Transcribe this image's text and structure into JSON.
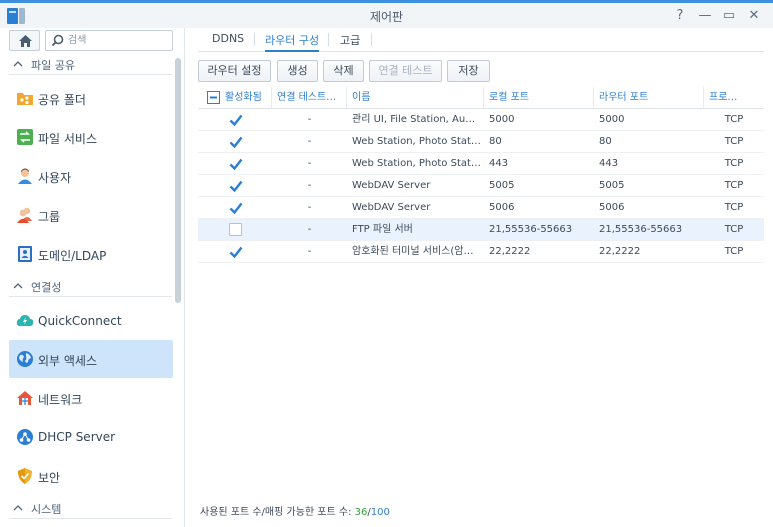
{
  "window": {
    "title": "제어판"
  },
  "title_buttons": {
    "help": "?",
    "minimize": "—",
    "maximize": "▭",
    "close": "✕"
  },
  "sidebar": {
    "search_placeholder": "검색",
    "sections": [
      {
        "label": "파일 공유"
      },
      {
        "label": "연결성"
      },
      {
        "label": "시스템"
      }
    ],
    "items": [
      {
        "label": "공유 폴더",
        "icon": "shared-folder-icon"
      },
      {
        "label": "파일 서비스",
        "icon": "file-services-icon"
      },
      {
        "label": "사용자",
        "icon": "user-icon"
      },
      {
        "label": "그룹",
        "icon": "group-icon"
      },
      {
        "label": "도메인/LDAP",
        "icon": "domain-ldap-icon"
      },
      {
        "label": "QuickConnect",
        "icon": "quickconnect-icon"
      },
      {
        "label": "외부 액세스",
        "icon": "external-access-icon",
        "active": true
      },
      {
        "label": "네트워크",
        "icon": "network-icon"
      },
      {
        "label": "DHCP Server",
        "icon": "dhcp-server-icon"
      },
      {
        "label": "보안",
        "icon": "security-shield-icon"
      }
    ]
  },
  "tabs": [
    {
      "label": "DDNS"
    },
    {
      "label": "라우터 구성",
      "active": true
    },
    {
      "label": "고급"
    }
  ],
  "toolbar": {
    "router_setup": "라우터 설정",
    "create": "생성",
    "delete": "삭제",
    "test_connection": "연결 테스트",
    "save": "저장"
  },
  "grid": {
    "headers": {
      "enabled": "활성화됨",
      "test_result": "연결 테스트…",
      "name": "이름",
      "local_port": "로컬 포트",
      "router_port": "라우터 포트",
      "protocol": "프로…"
    },
    "rows": [
      {
        "enabled": true,
        "test": "-",
        "name": "관리 UI, File Station, Au…",
        "local": "5000",
        "router": "5000",
        "proto": "TCP"
      },
      {
        "enabled": true,
        "test": "-",
        "name": "Web Station, Photo Stati…",
        "local": "80",
        "router": "80",
        "proto": "TCP"
      },
      {
        "enabled": true,
        "test": "-",
        "name": "Web Station, Photo Stati…",
        "local": "443",
        "router": "443",
        "proto": "TCP"
      },
      {
        "enabled": true,
        "test": "-",
        "name": "WebDAV Server",
        "local": "5005",
        "router": "5005",
        "proto": "TCP"
      },
      {
        "enabled": true,
        "test": "-",
        "name": "WebDAV Server",
        "local": "5006",
        "router": "5006",
        "proto": "TCP"
      },
      {
        "enabled": false,
        "test": "-",
        "name": "FTP 파일 서버",
        "local": "21,55536-55663",
        "router": "21,55536-55663",
        "proto": "TCP",
        "selected": true
      },
      {
        "enabled": true,
        "test": "-",
        "name": "암호화된 터미널 서비스(암…",
        "local": "22,2222",
        "router": "22,2222",
        "proto": "TCP"
      }
    ]
  },
  "footer": {
    "label": "사용된 포트 수/매핑 가능한 포트 수: ",
    "used": "36",
    "slash": "/",
    "total": "100"
  },
  "colors": {
    "accent": "#2e7fd0",
    "selected_item": "#cde4fa",
    "check": "#2a7fd4",
    "used_green": "#3aa03a"
  }
}
